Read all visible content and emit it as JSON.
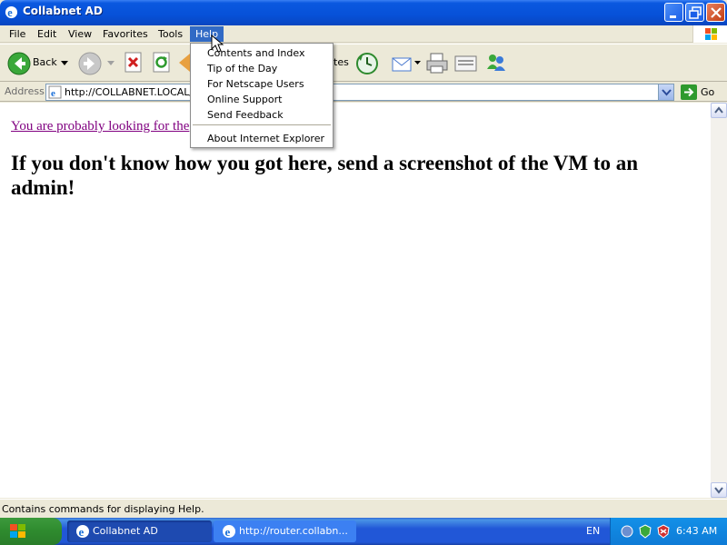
{
  "window": {
    "title": "Collabnet AD"
  },
  "menubar": {
    "items": [
      "File",
      "Edit",
      "View",
      "Favorites",
      "Tools",
      "Help"
    ],
    "active": "Help"
  },
  "toolbar": {
    "back_label": "Back",
    "favorites_partial": "tes",
    "go_label": "Go"
  },
  "address": {
    "label": "Address",
    "url": "http://COLLABNET.LOCAL/"
  },
  "help_menu": {
    "items": [
      "Contents and Index",
      "Tip of the Day",
      "For Netscape Users",
      "Online Support",
      "Send Feedback"
    ],
    "about": "About Internet Explorer"
  },
  "page": {
    "link_text": "You are probably looking for the",
    "heading": "If you don't know how you got here, send a screenshot of the VM to an admin!"
  },
  "status": {
    "text": "Contains commands for displaying Help."
  },
  "taskbar": {
    "tasks": [
      "Collabnet AD",
      "http://router.collabn..."
    ],
    "language": "EN",
    "clock": "6:43 AM"
  },
  "colors": {
    "titlebar": "#0751d8",
    "menu_highlight": "#316ac5",
    "link_visited": "#800080"
  },
  "icons": [
    "ie-icon",
    "minimize-icon",
    "maximize-icon",
    "close-icon",
    "windows-flag-icon",
    "back-icon",
    "forward-icon",
    "stop-icon",
    "refresh-icon",
    "history-icon",
    "mail-icon",
    "print-icon",
    "edit-icon",
    "messenger-icon",
    "go-arrow-icon",
    "start-icon"
  ]
}
